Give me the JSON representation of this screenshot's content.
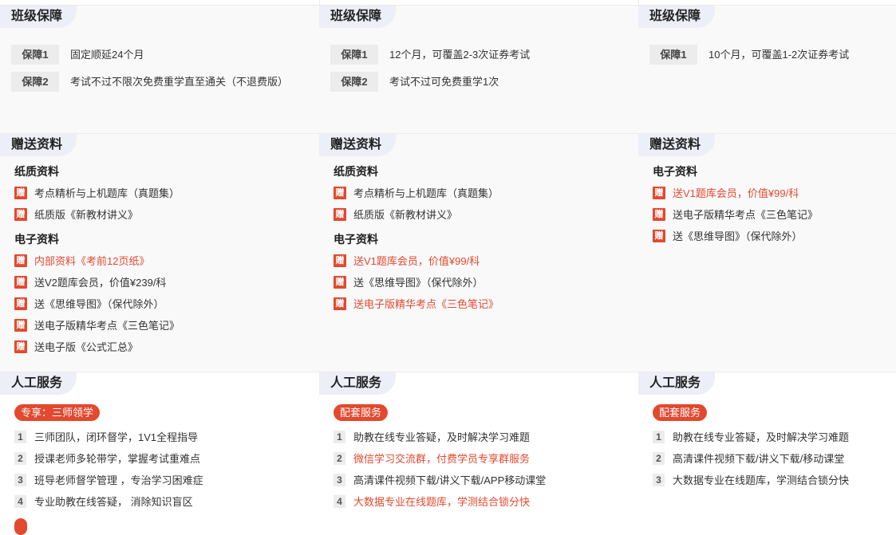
{
  "sections": {
    "guarantee_title": "班级保障",
    "gifts_title": "赠送资料",
    "service_title": "人工服务"
  },
  "gift_badge": "赠",
  "columns": [
    {
      "guarantees": [
        {
          "tag": "保障1",
          "text": "固定顺延24个月"
        },
        {
          "tag": "保障2",
          "text": "考试不过不限次免费重学直至通关（不退费版）"
        }
      ],
      "paper_title": "纸质资料",
      "paper": [
        {
          "text": "考点精析与上机题库（真题集）",
          "highlight": false
        },
        {
          "text": "纸质版《新教材讲义》",
          "highlight": false
        }
      ],
      "digital_title": "电子资料",
      "digital": [
        {
          "text": "内部资料《考前12页纸》",
          "highlight": true
        },
        {
          "text": "送V2题库会员，价值¥239/科",
          "highlight": false
        },
        {
          "text": "送《思维导图》（保代除外）",
          "highlight": false
        },
        {
          "text": "送电子版精华考点《三色笔记》",
          "highlight": false
        },
        {
          "text": "送电子版《公式汇总》",
          "highlight": false
        }
      ],
      "service_pill": "专享：三师领学",
      "services": [
        {
          "num": "1",
          "text": "三师团队，闭环督学，1V1全程指导",
          "highlight": false
        },
        {
          "num": "2",
          "text": "授课老师多轮带学，掌握考试重难点",
          "highlight": false
        },
        {
          "num": "3",
          "text": "班导老师督学管理 ，专治学习困难症",
          "highlight": false
        },
        {
          "num": "4",
          "text": "专业助教在线答疑， 消除知识盲区",
          "highlight": false
        }
      ]
    },
    {
      "guarantees": [
        {
          "tag": "保障1",
          "text": "12个月，可覆盖2-3次证券考试"
        },
        {
          "tag": "保障2",
          "text": "考试不过可免费重学1次"
        }
      ],
      "paper_title": "纸质资料",
      "paper": [
        {
          "text": "考点精析与上机题库（真题集）",
          "highlight": false
        },
        {
          "text": "纸质版《新教材讲义》",
          "highlight": false
        }
      ],
      "digital_title": "电子资料",
      "digital": [
        {
          "text": "送V1题库会员，价值¥99/科",
          "highlight": true
        },
        {
          "text": "送《思维导图》（保代除外）",
          "highlight": false
        },
        {
          "text": "送电子版精华考点《三色笔记》",
          "highlight": true
        }
      ],
      "service_pill": "配套服务",
      "services": [
        {
          "num": "1",
          "text": "助教在线专业答疑，及时解决学习难题",
          "highlight": false
        },
        {
          "num": "2",
          "text": "微信学习交流群，付费学员专享群服务",
          "highlight": true
        },
        {
          "num": "3",
          "text": "高清课件视频下载/讲义下载/APP移动课堂",
          "highlight": false
        },
        {
          "num": "4",
          "text": "大数据专业在线题库，学测结合锁分快",
          "highlight": true
        }
      ]
    },
    {
      "guarantees": [
        {
          "tag": "保障1",
          "text": "10个月，可覆盖1-2次证券考试"
        }
      ],
      "digital_title": "电子资料",
      "digital": [
        {
          "text": "送V1题库会员，价值¥99/科",
          "highlight": true
        },
        {
          "text": "送电子版精华考点《三色笔记》",
          "highlight": false
        },
        {
          "text": "送《思维导图》（保代除外）",
          "highlight": false
        }
      ],
      "service_pill": "配套服务",
      "services": [
        {
          "num": "1",
          "text": "助教在线专业答疑，及时解决学习难题",
          "highlight": false
        },
        {
          "num": "2",
          "text": "高清课件视频下载/讲义下载/移动课堂",
          "highlight": false
        },
        {
          "num": "3",
          "text": "大数据专业在线题库，学测结合锁分快",
          "highlight": false
        }
      ]
    }
  ],
  "colors": {
    "accent_red": "#e2492f",
    "tab_bg": "#eceff7",
    "tag_bg": "#ececec"
  }
}
